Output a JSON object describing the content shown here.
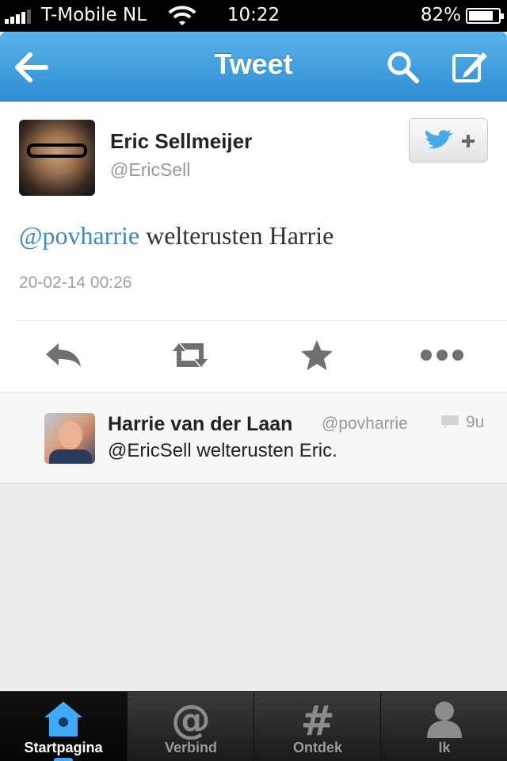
{
  "status_bar": {
    "carrier": "T-Mobile NL",
    "time": "10:22",
    "battery_percent": "82%",
    "battery_level": 0.82,
    "signal_bars": 4
  },
  "nav": {
    "title": "Tweet",
    "accent_color": "#3a9be0",
    "icons": [
      "back-arrow-icon",
      "search-icon",
      "compose-icon"
    ]
  },
  "tweet": {
    "author_name": "Eric Sellmeijer",
    "author_handle": "@EricSell",
    "mention": "@povharrie",
    "text": " welterusten Harrie",
    "timestamp": "20-02-14 00:26",
    "follow_icon": "twitter-bird-plus-icon",
    "actions": [
      "reply-icon",
      "retweet-icon",
      "favorite-star-icon",
      "more-dots-icon"
    ]
  },
  "reply": {
    "author_name": "Harrie van der Laan",
    "author_handle": "@povharrie",
    "time": "9u",
    "text": "@EricSell welterusten Eric.",
    "icon": "conversation-bubble-icon"
  },
  "tab_bar": {
    "active_index": 0,
    "tabs": [
      {
        "label": "Startpagina",
        "icon": "home-birdhouse-icon"
      },
      {
        "label": "Verbind",
        "icon": "at-sign-icon"
      },
      {
        "label": "Ontdek",
        "icon": "hashtag-icon"
      },
      {
        "label": "Ik",
        "icon": "person-icon"
      }
    ]
  }
}
